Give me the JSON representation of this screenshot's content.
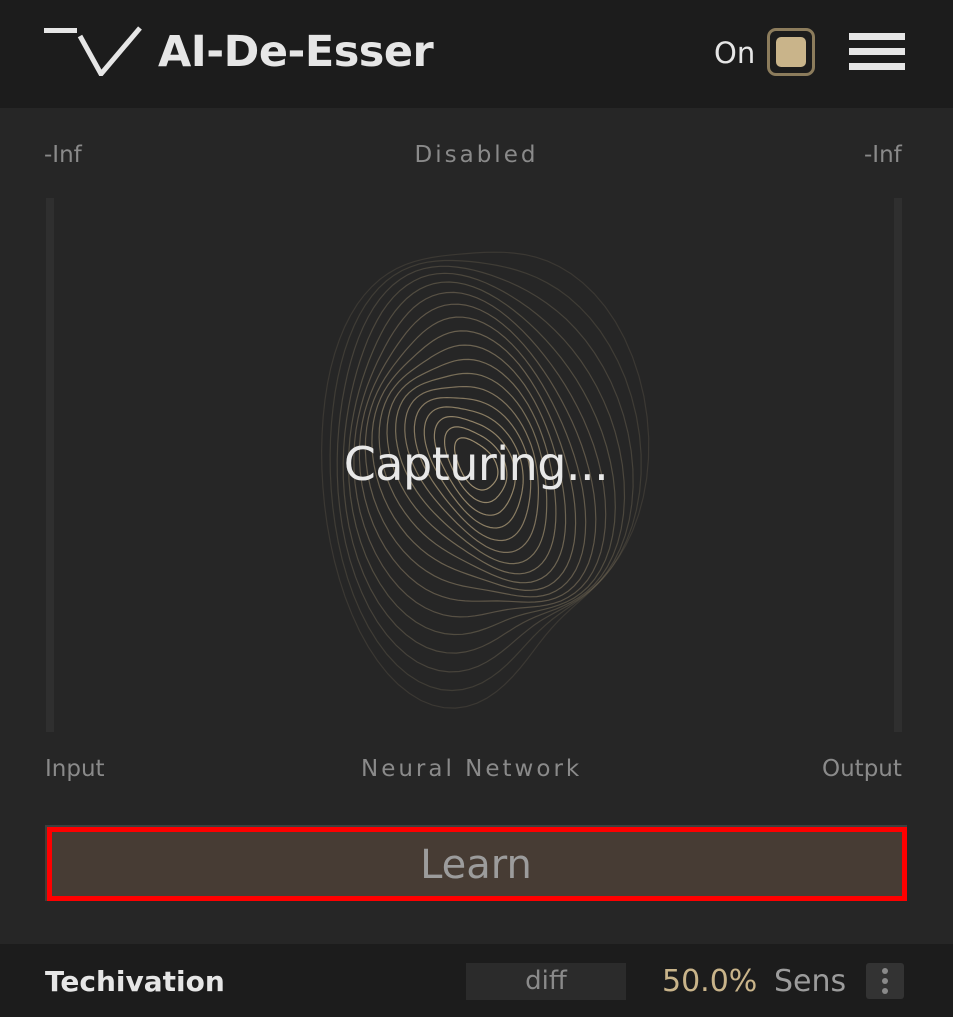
{
  "header": {
    "title": "AI-De-Esser",
    "power_label": "On",
    "power_state": "on",
    "menu_icon": "hamburger-menu-icon",
    "logo": "TV"
  },
  "meters": {
    "input_value": "-Inf",
    "output_value": "-Inf",
    "status": "Disabled",
    "input_label": "Input",
    "network_label": "Neural Network",
    "output_label": "Output"
  },
  "visual": {
    "overlay_text": "Capturing..."
  },
  "learn": {
    "label": "Learn"
  },
  "footer": {
    "brand": "Techivation",
    "diff_label": "diff",
    "sens_value": "50.0%",
    "sens_label": "Sens",
    "more_icon": "kebab-menu-icon"
  },
  "colors": {
    "accent": "#c9b48a",
    "learn_bg": "#473c34",
    "highlight": "#ff0000",
    "header_bg": "#1c1c1c",
    "panel_bg": "#262626"
  }
}
